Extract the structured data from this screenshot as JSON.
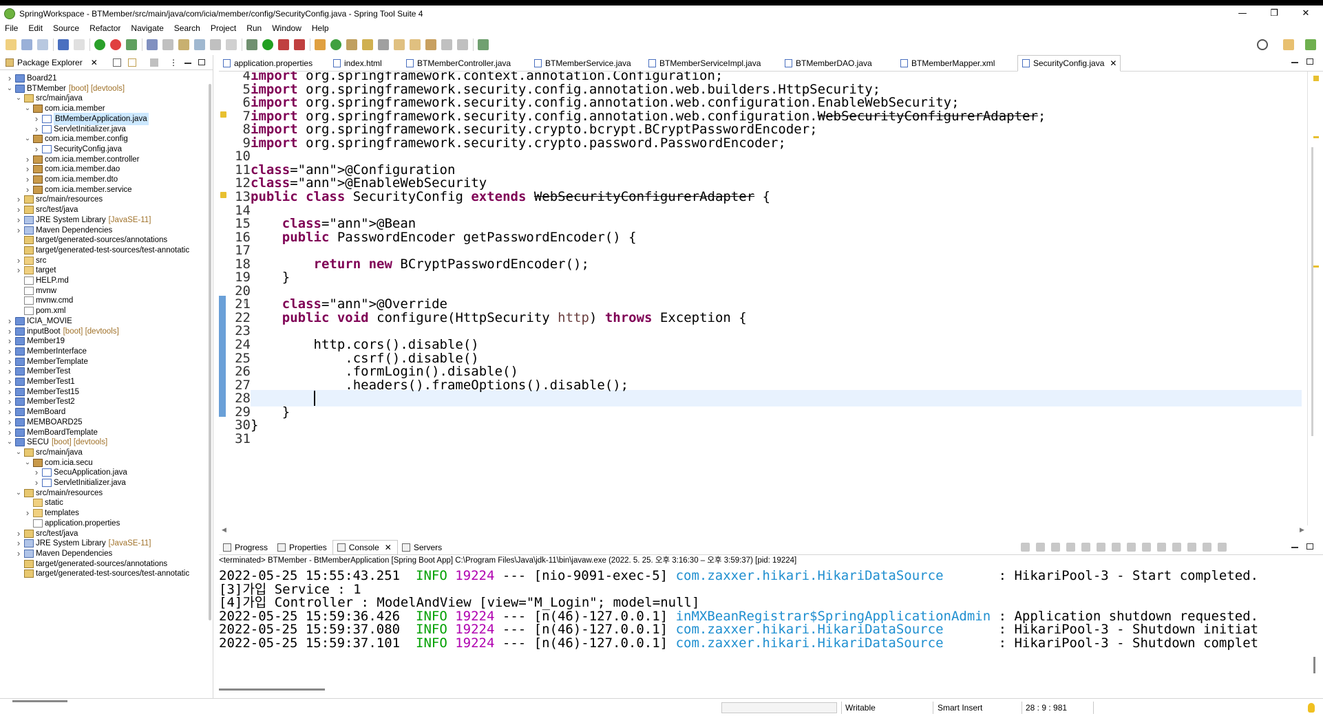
{
  "window": {
    "title": "SpringWorkspace - BTMember/src/main/java/com/icia/member/config/SecurityConfig.java - Spring Tool Suite 4",
    "minimize": "—",
    "maximize": "❐",
    "close": "✕"
  },
  "menu": [
    "File",
    "Edit",
    "Source",
    "Refactor",
    "Navigate",
    "Search",
    "Project",
    "Run",
    "Window",
    "Help"
  ],
  "package_explorer": {
    "tab_label": "Package Explorer",
    "items": [
      {
        "label": "Board21",
        "deco": "",
        "icon": "project-icon",
        "expanded": false,
        "indent": 0
      },
      {
        "label": "BTMember",
        "deco": "[boot] [devtools]",
        "icon": "project-icon",
        "expanded": true,
        "indent": 0
      },
      {
        "label": "src/main/java",
        "deco": "",
        "icon": "source-folder-icon",
        "expanded": true,
        "indent": 1
      },
      {
        "label": "com.icia.member",
        "deco": "",
        "icon": "package-icon",
        "expanded": true,
        "indent": 2
      },
      {
        "label": "BtMemberApplication.java",
        "deco": "",
        "icon": "java-file-icon",
        "expanded": false,
        "indent": 3,
        "selected": true
      },
      {
        "label": "ServletInitializer.java",
        "deco": "",
        "icon": "java-file-icon",
        "expanded": false,
        "indent": 3
      },
      {
        "label": "com.icia.member.config",
        "deco": "",
        "icon": "package-icon",
        "expanded": true,
        "indent": 2
      },
      {
        "label": "SecurityConfig.java",
        "deco": "",
        "icon": "java-file-icon",
        "expanded": false,
        "indent": 3
      },
      {
        "label": "com.icia.member.controller",
        "deco": "",
        "icon": "package-icon",
        "expanded": false,
        "indent": 2
      },
      {
        "label": "com.icia.member.dao",
        "deco": "",
        "icon": "package-icon",
        "expanded": false,
        "indent": 2
      },
      {
        "label": "com.icia.member.dto",
        "deco": "",
        "icon": "package-icon",
        "expanded": false,
        "indent": 2
      },
      {
        "label": "com.icia.member.service",
        "deco": "",
        "icon": "package-icon",
        "expanded": false,
        "indent": 2
      },
      {
        "label": "src/main/resources",
        "deco": "",
        "icon": "source-folder-icon",
        "expanded": false,
        "indent": 1
      },
      {
        "label": "src/test/java",
        "deco": "",
        "icon": "source-folder-icon",
        "expanded": false,
        "indent": 1
      },
      {
        "label": "JRE System Library",
        "deco": "[JavaSE-11]",
        "icon": "library-icon",
        "expanded": false,
        "indent": 1
      },
      {
        "label": "Maven Dependencies",
        "deco": "",
        "icon": "library-icon",
        "expanded": false,
        "indent": 1
      },
      {
        "label": "target/generated-sources/annotations",
        "deco": "",
        "icon": "source-folder-icon",
        "expanded": null,
        "indent": 1
      },
      {
        "label": "target/generated-test-sources/test-annotatic",
        "deco": "",
        "icon": "source-folder-icon",
        "expanded": null,
        "indent": 1
      },
      {
        "label": "src",
        "deco": "",
        "icon": "folder-icon",
        "expanded": false,
        "indent": 1
      },
      {
        "label": "target",
        "deco": "",
        "icon": "folder-icon",
        "expanded": false,
        "indent": 1
      },
      {
        "label": "HELP.md",
        "deco": "",
        "icon": "file-icon",
        "expanded": null,
        "indent": 1
      },
      {
        "label": "mvnw",
        "deco": "",
        "icon": "file-icon",
        "expanded": null,
        "indent": 1
      },
      {
        "label": "mvnw.cmd",
        "deco": "",
        "icon": "file-icon",
        "expanded": null,
        "indent": 1
      },
      {
        "label": "pom.xml",
        "deco": "",
        "icon": "file-icon",
        "expanded": null,
        "indent": 1
      },
      {
        "label": "ICIA_MOVIE",
        "deco": "",
        "icon": "project-icon",
        "expanded": false,
        "indent": 0
      },
      {
        "label": "inputBoot",
        "deco": "[boot] [devtools]",
        "icon": "project-icon",
        "expanded": false,
        "indent": 0
      },
      {
        "label": "Member19",
        "deco": "",
        "icon": "project-icon",
        "expanded": false,
        "indent": 0
      },
      {
        "label": "MemberInterface",
        "deco": "",
        "icon": "project-icon",
        "expanded": false,
        "indent": 0
      },
      {
        "label": "MemberTemplate",
        "deco": "",
        "icon": "project-icon",
        "expanded": false,
        "indent": 0
      },
      {
        "label": "MemberTest",
        "deco": "",
        "icon": "project-icon",
        "expanded": false,
        "indent": 0
      },
      {
        "label": "MemberTest1",
        "deco": "",
        "icon": "project-icon",
        "expanded": false,
        "indent": 0
      },
      {
        "label": "MemberTest15",
        "deco": "",
        "icon": "project-icon",
        "expanded": false,
        "indent": 0
      },
      {
        "label": "MemberTest2",
        "deco": "",
        "icon": "project-icon",
        "expanded": false,
        "indent": 0
      },
      {
        "label": "MemBoard",
        "deco": "",
        "icon": "project-icon",
        "expanded": false,
        "indent": 0
      },
      {
        "label": "MEMBOARD25",
        "deco": "",
        "icon": "project-icon",
        "expanded": false,
        "indent": 0
      },
      {
        "label": "MemBoardTemplate",
        "deco": "",
        "icon": "project-icon",
        "expanded": false,
        "indent": 0
      },
      {
        "label": "SECU",
        "deco": "[boot] [devtools]",
        "icon": "project-icon",
        "expanded": true,
        "indent": 0
      },
      {
        "label": "src/main/java",
        "deco": "",
        "icon": "source-folder-icon",
        "expanded": true,
        "indent": 1
      },
      {
        "label": "com.icia.secu",
        "deco": "",
        "icon": "package-icon",
        "expanded": true,
        "indent": 2
      },
      {
        "label": "SecuApplication.java",
        "deco": "",
        "icon": "java-file-icon",
        "expanded": false,
        "indent": 3
      },
      {
        "label": "ServletInitializer.java",
        "deco": "",
        "icon": "java-file-icon",
        "expanded": false,
        "indent": 3
      },
      {
        "label": "src/main/resources",
        "deco": "",
        "icon": "source-folder-icon",
        "expanded": true,
        "indent": 1
      },
      {
        "label": "static",
        "deco": "",
        "icon": "folder-icon",
        "expanded": null,
        "indent": 2
      },
      {
        "label": "templates",
        "deco": "",
        "icon": "folder-icon",
        "expanded": false,
        "indent": 2
      },
      {
        "label": "application.properties",
        "deco": "",
        "icon": "file-icon",
        "expanded": null,
        "indent": 2
      },
      {
        "label": "src/test/java",
        "deco": "",
        "icon": "source-folder-icon",
        "expanded": false,
        "indent": 1
      },
      {
        "label": "JRE System Library",
        "deco": "[JavaSE-11]",
        "icon": "library-icon",
        "expanded": false,
        "indent": 1
      },
      {
        "label": "Maven Dependencies",
        "deco": "",
        "icon": "library-icon",
        "expanded": false,
        "indent": 1
      },
      {
        "label": "target/generated-sources/annotations",
        "deco": "",
        "icon": "source-folder-icon",
        "expanded": null,
        "indent": 1
      },
      {
        "label": "target/generated-test-sources/test-annotatic",
        "deco": "",
        "icon": "source-folder-icon",
        "expanded": null,
        "indent": 1
      }
    ]
  },
  "editor": {
    "tabs": [
      {
        "label": "application.properties",
        "active": false
      },
      {
        "label": "index.html",
        "active": false
      },
      {
        "label": "BTMemberController.java",
        "active": false
      },
      {
        "label": "BTMemberService.java",
        "active": false
      },
      {
        "label": "BTMemberServiceImpl.java",
        "active": false
      },
      {
        "label": "BTMemberDAO.java",
        "active": false
      },
      {
        "label": "BTMemberMapper.xml",
        "active": false
      },
      {
        "label": "SecurityConfig.java",
        "active": true
      }
    ],
    "lines": [
      {
        "n": "4",
        "text": "import org.springframework.context.annotation.Configuration;"
      },
      {
        "n": "5",
        "text": "import org.springframework.security.config.annotation.web.builders.HttpSecurity;"
      },
      {
        "n": "6",
        "text": "import org.springframework.security.config.annotation.web.configuration.EnableWebSecurity;"
      },
      {
        "n": "7",
        "text": "import org.springframework.security.config.annotation.web.configuration.WebSecurityConfigurerAdapter;"
      },
      {
        "n": "8",
        "text": "import org.springframework.security.crypto.bcrypt.BCryptPasswordEncoder;"
      },
      {
        "n": "9",
        "text": "import org.springframework.security.crypto.password.PasswordEncoder;"
      },
      {
        "n": "10",
        "text": ""
      },
      {
        "n": "11",
        "text": "@Configuration"
      },
      {
        "n": "12",
        "text": "@EnableWebSecurity"
      },
      {
        "n": "13",
        "text": "public class SecurityConfig extends WebSecurityConfigurerAdapter {"
      },
      {
        "n": "14",
        "text": ""
      },
      {
        "n": "15",
        "text": "    @Bean"
      },
      {
        "n": "16",
        "text": "    public PasswordEncoder getPasswordEncoder() {"
      },
      {
        "n": "17",
        "text": ""
      },
      {
        "n": "18",
        "text": "        return new BCryptPasswordEncoder();"
      },
      {
        "n": "19",
        "text": "    }"
      },
      {
        "n": "20",
        "text": ""
      },
      {
        "n": "21",
        "text": "    @Override"
      },
      {
        "n": "22",
        "text": "    public void configure(HttpSecurity http) throws Exception {"
      },
      {
        "n": "23",
        "text": ""
      },
      {
        "n": "24",
        "text": "        http.cors().disable()"
      },
      {
        "n": "25",
        "text": "            .csrf().disable()"
      },
      {
        "n": "26",
        "text": "            .formLogin().disable()"
      },
      {
        "n": "27",
        "text": "            .headers().frameOptions().disable();"
      },
      {
        "n": "28",
        "text": ""
      },
      {
        "n": "29",
        "text": "    }"
      },
      {
        "n": "30",
        "text": "}"
      },
      {
        "n": "31",
        "text": ""
      }
    ]
  },
  "console": {
    "tabs": [
      {
        "label": "Progress",
        "active": false
      },
      {
        "label": "Properties",
        "active": false
      },
      {
        "label": "Console",
        "active": true
      },
      {
        "label": "Servers",
        "active": false
      }
    ],
    "terminated": "<terminated> BTMember - BtMemberApplication [Spring Boot App] C:\\Program Files\\Java\\jdk-11\\bin\\javaw.exe  (2022. 5. 25. 오후 3:16:30 – 오후 3:59:37) [pid: 19224]",
    "lines": [
      {
        "ts": "2022-05-25 15:55:43.251",
        "level": "INFO",
        "pid": "19224",
        "sep": "---",
        "thread": "[nio-9091-exec-5]",
        "logger": "com.zaxxer.hikari.HikariDataSource      ",
        "msg": ": HikariPool-3 - Start completed."
      },
      {
        "plain": "[3]가입 Service : 1"
      },
      {
        "plain": "[4]가입 Controller : ModelAndView [view=\"M_Login\"; model=null]"
      },
      {
        "ts": "2022-05-25 15:59:36.426",
        "level": "INFO",
        "pid": "19224",
        "sep": "---",
        "thread": "[n(46)-127.0.0.1]",
        "logger": "inMXBeanRegistrar$SpringApplicationAdmin",
        "msg": ": Application shutdown requested."
      },
      {
        "ts": "2022-05-25 15:59:37.080",
        "level": "INFO",
        "pid": "19224",
        "sep": "---",
        "thread": "[n(46)-127.0.0.1]",
        "logger": "com.zaxxer.hikari.HikariDataSource      ",
        "msg": ": HikariPool-3 - Shutdown initiat"
      },
      {
        "ts": "2022-05-25 15:59:37.101",
        "level": "INFO",
        "pid": "19224",
        "sep": "---",
        "thread": "[n(46)-127.0.0.1]",
        "logger": "com.zaxxer.hikari.HikariDataSource      ",
        "msg": ": HikariPool-3 - Shutdown complet"
      }
    ]
  },
  "status": {
    "writable": "Writable",
    "insert_mode": "Smart Insert",
    "position": "28 : 9 : 981"
  },
  "colors": {
    "keyword": "#7f0055",
    "annotation": "#646464",
    "info": "#00a000",
    "pid": "#b000b0",
    "logger": "#1f8fd0",
    "current_line": "#e8f2fe",
    "selection": "#cce8ff"
  }
}
